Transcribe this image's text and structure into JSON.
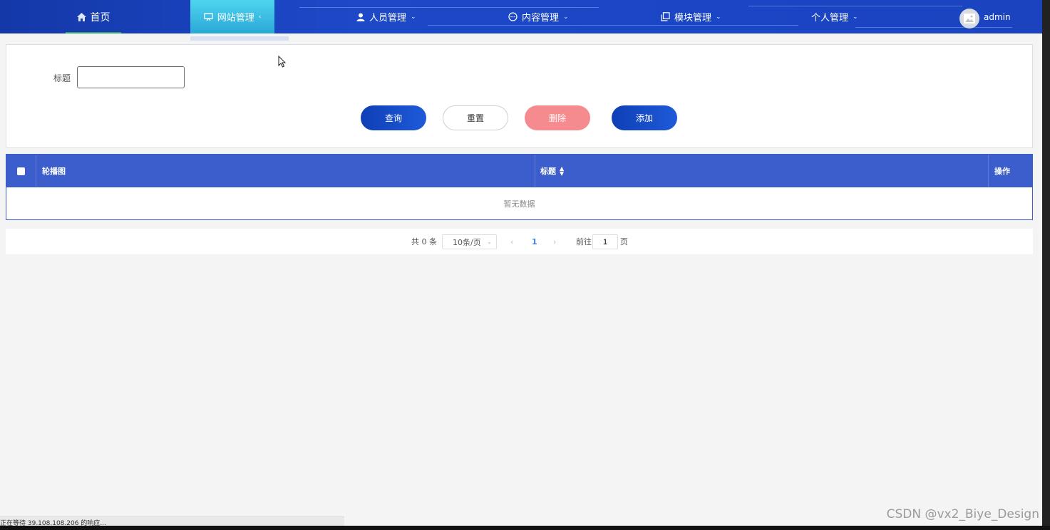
{
  "nav": {
    "home": "首页",
    "website": "网站管理",
    "people": "人员管理",
    "content": "内容管理",
    "modules": "模块管理",
    "personal": "个人管理",
    "user": "admin"
  },
  "search": {
    "title_label": "标题",
    "title_value": "",
    "buttons": {
      "query": "查询",
      "reset": "重置",
      "delete": "删除",
      "add": "添加"
    }
  },
  "table": {
    "columns": {
      "image": "轮播图",
      "title": "标题",
      "actions": "操作"
    },
    "empty_text": "暂无数据"
  },
  "pagination": {
    "total": "共 0 条",
    "page_size": "10条/页",
    "current_page": "1",
    "goto_label": "前往",
    "goto_value": "1",
    "page_unit": "页"
  },
  "status_bar": "正在等待 39.108.108.206 的响应...",
  "watermark": "CSDN @vx2_Biye_Design",
  "colors": {
    "nav_bg": "#1d49c9",
    "active_tab": "#2aa8d6",
    "table_header": "#3c5ecc",
    "primary_button": "#1f5ad9",
    "danger_button": "#f58b8f"
  }
}
